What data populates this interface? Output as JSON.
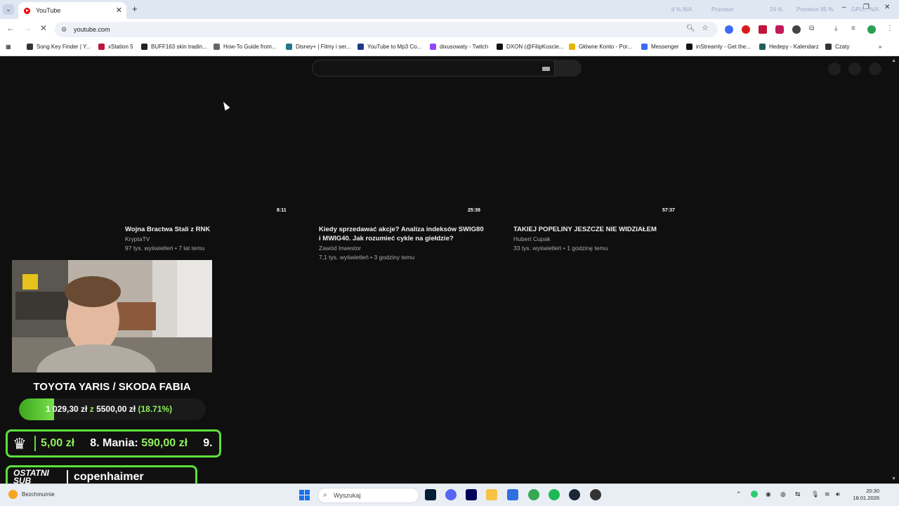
{
  "browser": {
    "tab_title": "YouTube",
    "tab_list_icon": "chevron-down-icon",
    "new_tab_label": "+",
    "window_controls": [
      "–",
      "❐",
      "✕"
    ],
    "sys_overlay": [
      "d % N/A",
      "Procesor",
      "24 %",
      "Procesor  85 %",
      "GPU... N/A"
    ],
    "url": "youtube.com",
    "bookmarks": [
      {
        "label": "Song Key Finder | Y...",
        "color": "#333333"
      },
      {
        "label": "xStation 5",
        "color": "#c0143c"
      },
      {
        "label": "BUFF163 skin tradin...",
        "color": "#222222"
      },
      {
        "label": "How-To Guide from...",
        "color": "#666666"
      },
      {
        "label": "Disney+ | Filmy i ser...",
        "color": "#1f7a8c"
      },
      {
        "label": "YouTube to Mp3 Co...",
        "color": "#1b3a8c"
      },
      {
        "label": "dixusowaty - Twitch",
        "color": "#9146ff"
      },
      {
        "label": "DXON (@FilipKoscie...",
        "color": "#111111"
      },
      {
        "label": "Główne Konto - Por...",
        "color": "#e8b400"
      },
      {
        "label": "Messenger",
        "color": "#3b6cf5"
      },
      {
        "label": "inStreamly - Get the...",
        "color": "#111111"
      },
      {
        "label": "Hedepy - Kalendarz",
        "color": "#1e5f5a"
      },
      {
        "label": "Czaty",
        "color": "#333333"
      }
    ]
  },
  "videos": [
    {
      "duration": "8:11",
      "title_lines": [
        "Wojna Bractwa Stali z RNK",
        ""
      ],
      "channel": "KryptaTV",
      "meta": "97 tys. wyświetleń • 7 lat temu"
    },
    {
      "duration": "25:39",
      "title_lines": [
        "Kiedy sprzedawać akcje? Analiza indeksów SWIG80",
        "i MWIG40. Jak rozumieć cykle na giełdzie?"
      ],
      "channel": "Zawód Inwestor",
      "meta": "7,1 tys. wyświetleń • 3 godziny temu"
    },
    {
      "duration": "57:37",
      "title_lines": [
        "TAKIEJ POPELINY JESZCZE NIE WIDZIAŁEM",
        ""
      ],
      "channel": "Hubert Cupak",
      "meta": "33 tys. wyświetleń • 1 godzinę temu"
    }
  ],
  "overlay": {
    "goal_title": "TOYOTA YARIS / SKODA FABIA",
    "goal_current": "1 029,30 zł",
    "goal_sep": "z",
    "goal_target": "5500,00 zł",
    "goal_percent_text": "(18.71%)",
    "goal_fraction": 0.1871,
    "ranking_text_a": "5,00 zł",
    "ranking_text_b": "8. Mania:",
    "ranking_text_c": "590,00 zł",
    "ranking_text_d": "9.",
    "last_sub_label_1": "OSTATNI",
    "last_sub_label_2": "SUB",
    "last_sub_name": "copenhaimer"
  },
  "taskbar": {
    "weather_text": "Bezchmurnie",
    "search_placeholder": "Wyszukaj",
    "time": "20:30",
    "date": "18.01.2026"
  }
}
